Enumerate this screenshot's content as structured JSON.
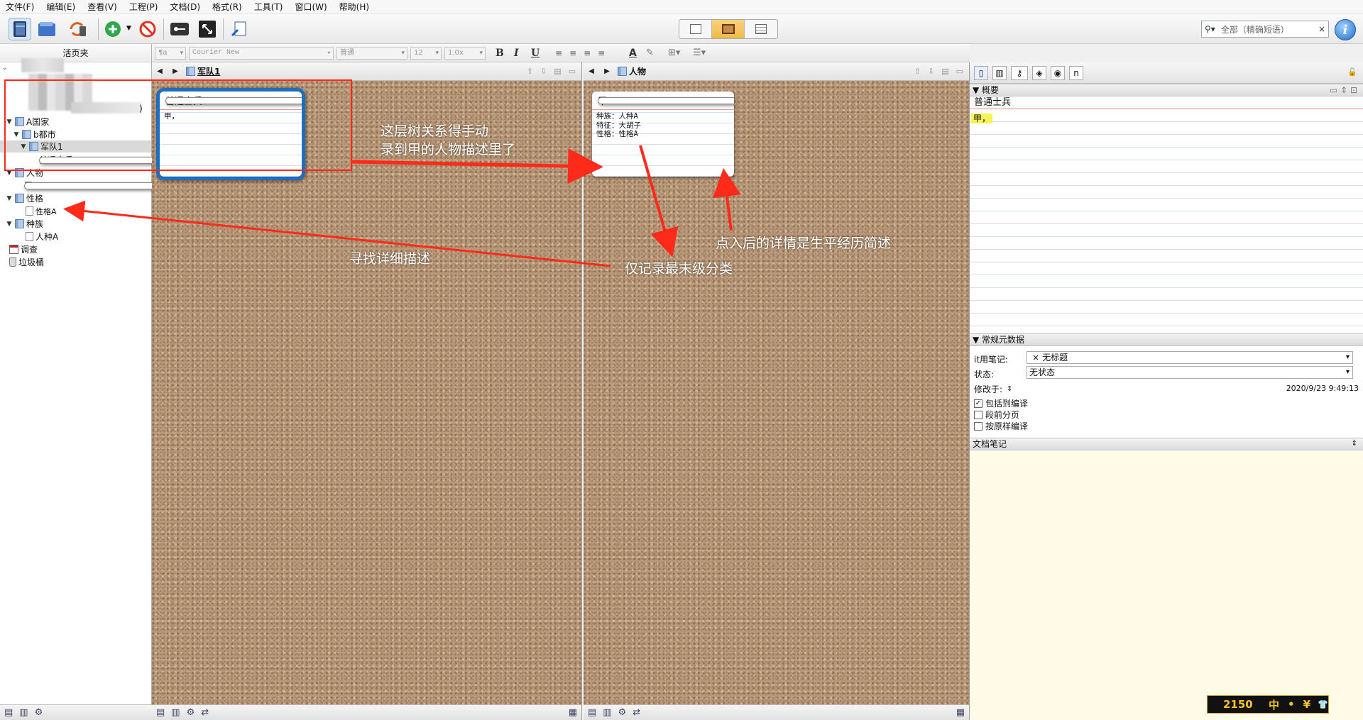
{
  "menu": [
    "文件(F)",
    "编辑(E)",
    "查看(V)",
    "工程(P)",
    "文档(D)",
    "格式(R)",
    "工具(T)",
    "窗口(W)",
    "帮助(H)"
  ],
  "search": {
    "placeholder": "全部（精确短语）",
    "clear": "×"
  },
  "info_button": "i",
  "binder": {
    "header": "活页夹",
    "items": [
      {
        "label": "A国家",
        "type": "folder"
      },
      {
        "label": "b都市",
        "type": "folder"
      },
      {
        "label": "军队1",
        "type": "folder"
      },
      {
        "label": "普通士兵",
        "type": "card"
      },
      {
        "label": "人物",
        "type": "folder"
      },
      {
        "label": "甲",
        "type": "card"
      },
      {
        "label": "性格",
        "type": "folder"
      },
      {
        "label": "性格A",
        "type": "doc"
      },
      {
        "label": "种族",
        "type": "folder"
      },
      {
        "label": "人种A",
        "type": "doc"
      },
      {
        "label": "调查",
        "type": "research"
      },
      {
        "label": "垃圾桶",
        "type": "trash"
      }
    ],
    "blurred_tail": ")"
  },
  "format_bar": {
    "style": "¶a",
    "font": "Courier New",
    "weight": "普通",
    "size": "12",
    "spacing": "1.0x",
    "bold": "B",
    "italic": "I",
    "underline": "U",
    "text_color": "A"
  },
  "left_pane": {
    "title": "军队1",
    "card": {
      "title": "普通士兵",
      "body": "甲，"
    }
  },
  "right_pane": {
    "title": "人物",
    "card": {
      "title": "甲",
      "lines": [
        "种族：人种A",
        "特征：大胡子",
        "性格：性格A"
      ]
    }
  },
  "inspector": {
    "synopsis_header": "概要",
    "synopsis_title": "普通士兵",
    "synopsis_text": "甲，",
    "metadata_header": "常规元数据",
    "label_field": "it用笔记:",
    "label_value": "无标题",
    "label_x": "×",
    "status_field": "状态:",
    "status_value": "无状态",
    "modified_field": "修改于:",
    "modified_value": "2020/9/23 9:49:13",
    "checkboxes": [
      {
        "label": "包括到编译",
        "checked": true
      },
      {
        "label": "段前分页",
        "checked": false
      },
      {
        "label": "按原样编译",
        "checked": false
      }
    ],
    "notes_header": "文档笔记"
  },
  "annotations": {
    "note1_line1": "这层树关系得手动",
    "note1_line2": "录到甲的人物描述里了",
    "note2": "点入后的详情是生平经历简述",
    "note3": "寻找详细描述",
    "note4": "仅记录最末级分类"
  },
  "colors": {
    "annotation": "#ff2a1a",
    "selection_border": "#1e6ec0",
    "mode_active": "#f0c050",
    "notes_bg": "#fffbe6"
  },
  "ime": {
    "count": "2150",
    "chars": [
      "中",
      "•",
      "¥",
      "👕"
    ]
  }
}
